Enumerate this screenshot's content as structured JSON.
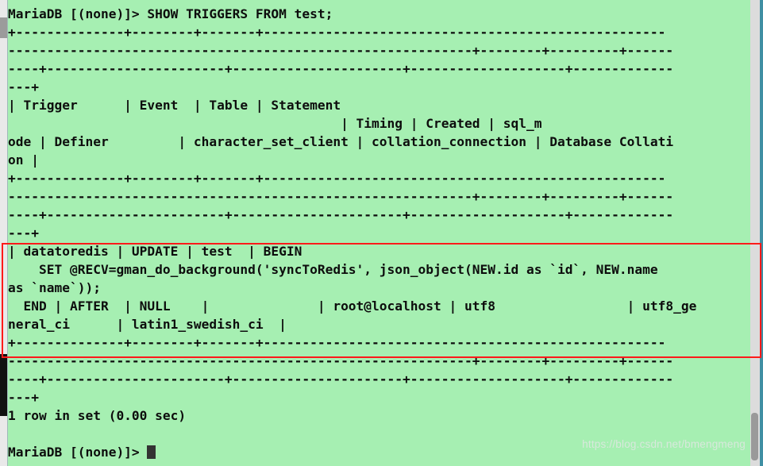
{
  "terminal": {
    "prompt": "MariaDB [(none)]>",
    "command": " SHOW TRIGGERS FROM test;",
    "lines": [
      "MariaDB [(none)]> SHOW TRIGGERS FROM test;",
      "+--------------+--------+-------+----------------------------------------------------",
      "------------------------------------------------------------+--------+---------+------",
      "----+-----------------------+----------------------+--------------------+-------------",
      "---+",
      "| Trigger      | Event  | Table | Statement",
      "                                           | Timing | Created | sql_m",
      "ode | Definer         | character_set_client | collation_connection | Database Collati",
      "on |",
      "+--------------+--------+-------+----------------------------------------------------",
      "------------------------------------------------------------+--------+---------+------",
      "----+-----------------------+----------------------+--------------------+-------------",
      "---+",
      "| datatoredis | UPDATE | test  | BEGIN",
      "    SET @RECV=gman_do_background('syncToRedis', json_object(NEW.id as `id`, NEW.name",
      "as `name`));",
      "  END | AFTER  | NULL    |              | root@localhost | utf8                 | utf8_ge",
      "neral_ci      | latin1_swedish_ci  |",
      "+--------------+--------+-------+----------------------------------------------------",
      "------------------------------------------------------------+--------+---------+------",
      "----+-----------------------+----------------------+--------------------+-------------",
      "---+",
      "1 row in set (0.00 sec)",
      "",
      "MariaDB [(none)]> "
    ],
    "result_status": "1 row in set (0.00 sec)",
    "table": {
      "headers": [
        "Trigger",
        "Event",
        "Table",
        "Statement",
        "Timing",
        "Created",
        "sql_mode",
        "Definer",
        "character_set_client",
        "collation_connection",
        "Database Collation"
      ],
      "rows": [
        {
          "Trigger": "datatoredis",
          "Event": "UPDATE",
          "Table": "test",
          "Statement": "BEGIN     SET @RECV=gman_do_background('syncToRedis', json_object(NEW.id as `id`, NEW.name as `name`));   END",
          "Timing": "AFTER",
          "Created": "NULL",
          "sql_mode": "",
          "Definer": "root@localhost",
          "character_set_client": "utf8",
          "collation_connection": "utf8_general_ci",
          "Database Collation": "latin1_swedish_ci"
        }
      ]
    }
  },
  "annotation": {
    "highlight_color": "#ff1a1a",
    "label": "highlighted-trigger-row"
  },
  "watermark": {
    "text": "https://blog.csdn.net/bmengmeng"
  },
  "colors": {
    "background": "#a6efb2",
    "text": "#0d0d0d",
    "window_chrome": "#3f8fa3",
    "scrollbar_track": "#dcdcdc",
    "scrollbar_thumb": "#9a9a9a"
  }
}
